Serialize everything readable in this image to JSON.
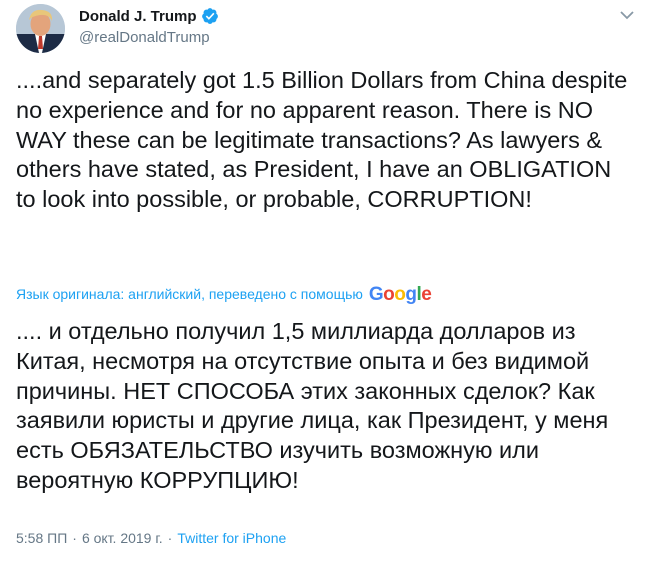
{
  "author": {
    "display_name": "Donald J. Trump",
    "handle": "@realDonaldTrump",
    "verified_icon": "verified-badge-icon",
    "avatar_icon": "avatar"
  },
  "tweet": {
    "text": "....and separately got 1.5 Billion Dollars from China despite no experience and for no apparent reason. There is NO WAY these can be legitimate transactions? As lawyers & others have stated, as President, I have an OBLIGATION to look into possible, or probable, CORRUPTION!"
  },
  "translation": {
    "note": "Язык оригинала: английский, переведено с помощью",
    "provider_letters": [
      "G",
      "o",
      "o",
      "g",
      "l",
      "e"
    ],
    "text": ".... и отдельно получил 1,5 миллиарда долларов из Китая, несмотря на отсутствие опыта и без видимой причины. НЕТ СПОСОБА этих законных сделок? Как заявили юристы и другие лица, как Президент, у меня есть ОБЯЗАТЕЛЬСТВО изучить возможную или вероятную КОРРУПЦИЮ!"
  },
  "meta": {
    "time": "5:58 ПП",
    "separator": "·",
    "date": "6 окт. 2019 г.",
    "source": "Twitter for iPhone"
  },
  "colors": {
    "link": "#1da1f2",
    "muted": "#657786",
    "text": "#14171a",
    "google_blue": "#4285f4",
    "google_red": "#ea4335",
    "google_yellow": "#fbbc05",
    "google_green": "#34a853"
  }
}
